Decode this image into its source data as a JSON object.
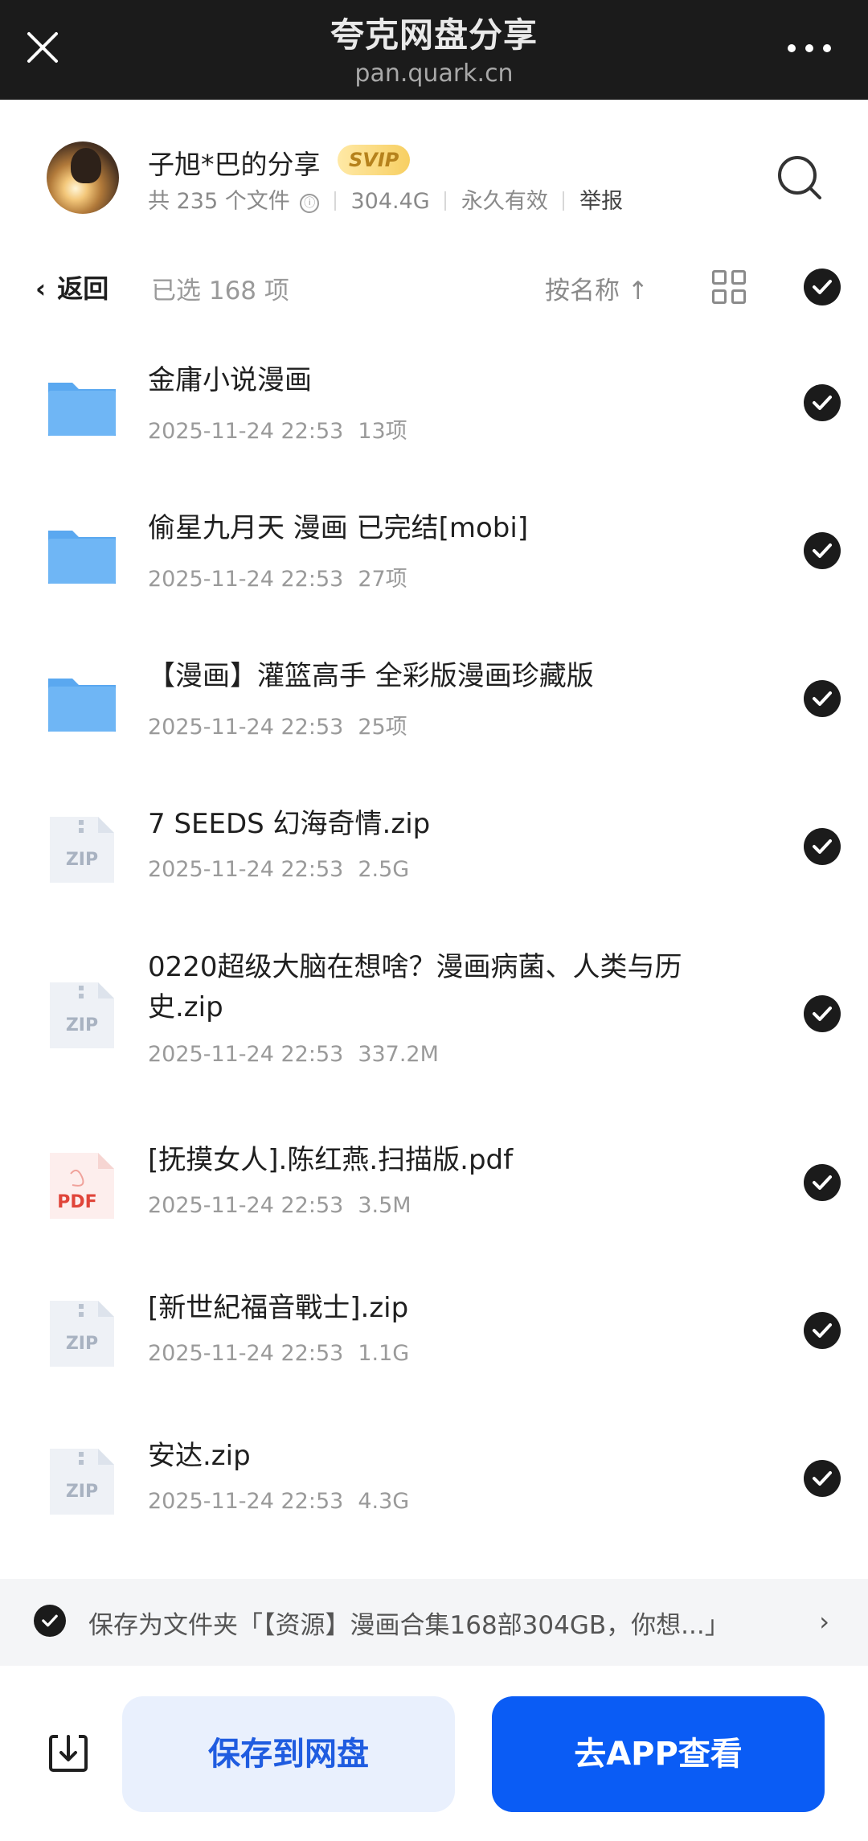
{
  "topbar": {
    "title": "夸克网盘分享",
    "subtitle": "pan.quark.cn"
  },
  "share": {
    "name": "子旭*巴的分享",
    "badge": "SVIP",
    "file_count": "共 235 个文件",
    "info_icon": "ⓘ",
    "total_size": "304.4G",
    "validity": "永久有效",
    "report": "举报"
  },
  "toolbar": {
    "back_label": "返回",
    "selected_label": "已选 168 项",
    "sort_label": "按名称 ↑"
  },
  "files": [
    {
      "type": "folder",
      "name": "金庸小说漫画",
      "date": "2025-11-24 22:53",
      "size": "13项"
    },
    {
      "type": "folder",
      "name": "偷星九月天 漫画 已完结[mobi]",
      "date": "2025-11-24 22:53",
      "size": "27项"
    },
    {
      "type": "folder",
      "name": "【漫画】灌篮高手 全彩版漫画珍藏版",
      "date": "2025-11-24 22:53",
      "size": "25项"
    },
    {
      "type": "zip",
      "name": "7 SEEDS 幻海奇情.zip",
      "date": "2025-11-24 22:53",
      "size": "2.5G"
    },
    {
      "type": "zip",
      "name": "0220超级大脑在想啥？漫画病菌、人类与历史.zip",
      "date": "2025-11-24 22:53",
      "size": "337.2M"
    },
    {
      "type": "pdf",
      "name": "[抚摸女人].陈红燕.扫描版.pdf",
      "date": "2025-11-24 22:53",
      "size": "3.5M"
    },
    {
      "type": "zip",
      "name": "[新世紀福音戰士].zip",
      "date": "2025-11-24 22:53",
      "size": "1.1G"
    },
    {
      "type": "zip",
      "name": "安达.zip",
      "date": "2025-11-24 22:53",
      "size": "4.3G"
    }
  ],
  "icon_labels": {
    "zip": "ZIP",
    "pdf": "PDF"
  },
  "saveas": {
    "text": "保存为文件夹「【资源】漫画合集168部304GB，你想...」",
    "chevron": "›"
  },
  "actions": {
    "save_label": "保存到网盘",
    "app_label": "去APP查看"
  },
  "colors": {
    "accent": "#0a5cf5",
    "topbar_bg": "#1b1b1b",
    "folder_blue": "#5aa8f0",
    "pdf_red": "#e0453a"
  }
}
